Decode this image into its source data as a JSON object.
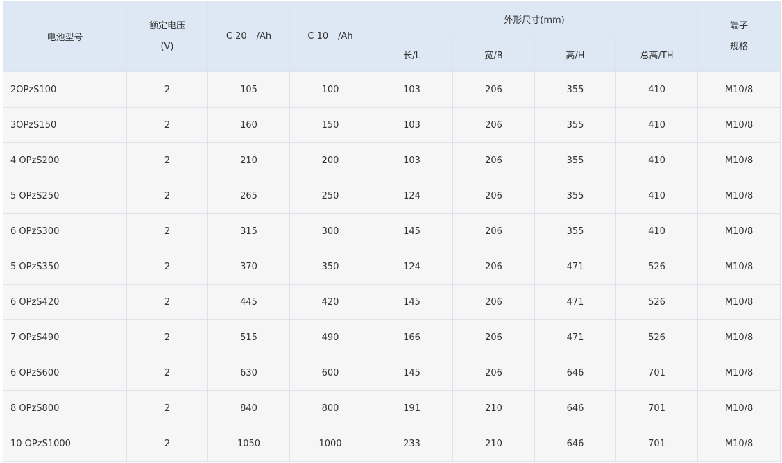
{
  "header": {
    "model": "电池型号",
    "voltage_line1": "额定电压",
    "voltage_line2": "(V)",
    "c20_a": "C 20",
    "c20_b": "/Ah",
    "c10_a": "C 10",
    "c10_b": "/Ah",
    "dimensions": "外形尺寸(mm)",
    "length": "长/L",
    "width": "宽/B",
    "height": "高/H",
    "total_height": "总高/TH",
    "terminal_line1": "端子",
    "terminal_line2": "规格"
  },
  "rows": [
    [
      "2OPzS100",
      "2",
      "105",
      "100",
      "103",
      "206",
      "355",
      "410",
      "M10/8"
    ],
    [
      "3OPzS150",
      "2",
      "160",
      "150",
      "103",
      "206",
      "355",
      "410",
      "M10/8"
    ],
    [
      "4 OPzS200",
      "2",
      "210",
      "200",
      "103",
      "206",
      "355",
      "410",
      "M10/8"
    ],
    [
      "5 OPzS250",
      "2",
      "265",
      "250",
      "124",
      "206",
      "355",
      "410",
      "M10/8"
    ],
    [
      "6 OPzS300",
      "2",
      "315",
      "300",
      "145",
      "206",
      "355",
      "410",
      "M10/8"
    ],
    [
      "5 OPzS350",
      "2",
      "370",
      "350",
      "124",
      "206",
      "471",
      "526",
      "M10/8"
    ],
    [
      "6 OPzS420",
      "2",
      "445",
      "420",
      "145",
      "206",
      "471",
      "526",
      "M10/8"
    ],
    [
      "7 OPzS490",
      "2",
      "515",
      "490",
      "166",
      "206",
      "471",
      "526",
      "M10/8"
    ],
    [
      "6 OPzS600",
      "2",
      "630",
      "600",
      "145",
      "206",
      "646",
      "701",
      "M10/8"
    ],
    [
      "8 OPzS800",
      "2",
      "840",
      "800",
      "191",
      "210",
      "646",
      "701",
      "M10/8"
    ],
    [
      "10 OPzS1000",
      "2",
      "1050",
      "1000",
      "233",
      "210",
      "646",
      "701",
      "M10/8"
    ]
  ]
}
